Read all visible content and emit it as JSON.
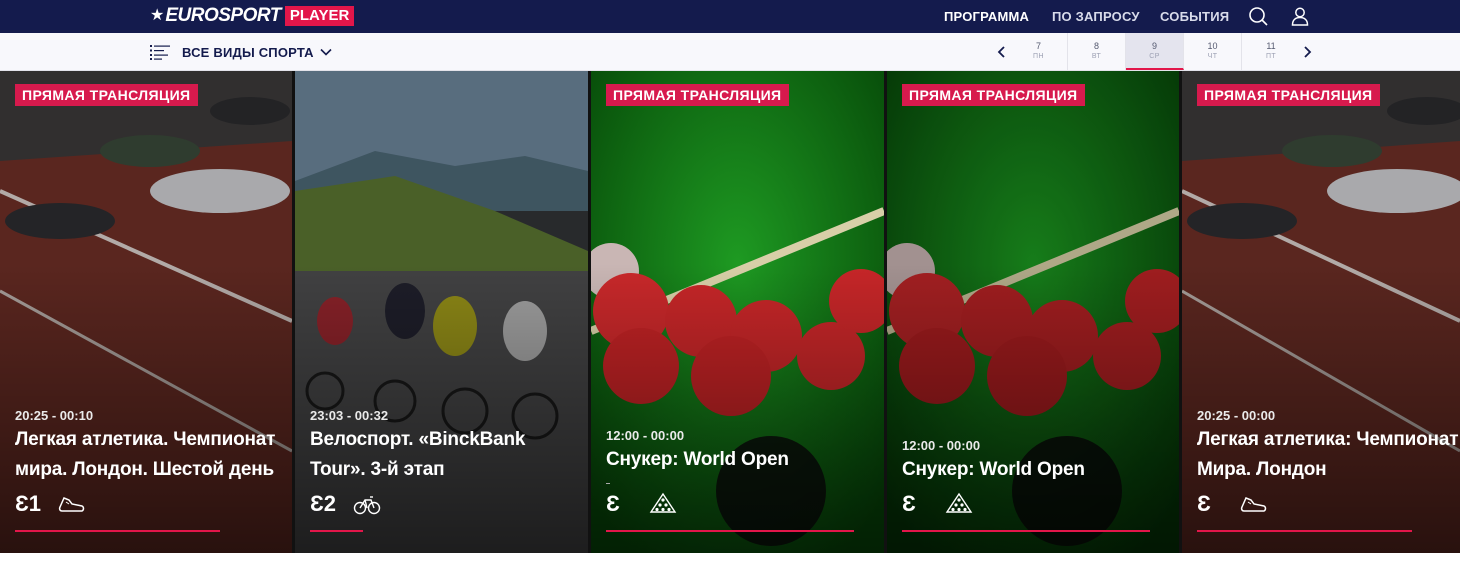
{
  "brand": {
    "name": "EUROSPORT",
    "product": "PLAYER"
  },
  "nav": {
    "links": [
      {
        "label": "ПРОГРАММА",
        "active": true
      },
      {
        "label": "ПО ЗАПРОСУ",
        "active": false
      },
      {
        "label": "СОБЫТИЯ",
        "active": false
      }
    ],
    "icons": [
      "search-icon",
      "user-icon"
    ]
  },
  "filter": {
    "label": "ВСЕ ВИДЫ СПОРТА"
  },
  "dates": [
    {
      "num": "7",
      "dow": "ПН",
      "active": false
    },
    {
      "num": "8",
      "dow": "ВТ",
      "active": false
    },
    {
      "num": "9",
      "dow": "СР",
      "active": true
    },
    {
      "num": "10",
      "dow": "ЧТ",
      "active": false
    },
    {
      "num": "11",
      "dow": "ПТ",
      "active": false
    }
  ],
  "colors": {
    "navy": "#141b4d",
    "accent": "#e2164a",
    "live_badge": "#d71a4d"
  },
  "cards": [
    {
      "live": "ПРЯМАЯ ТРАНСЛЯЦИЯ",
      "time": "20:25 - 00:10",
      "title": "Легкая атлетика. Чемпионат мира. Лондон. Шестой день",
      "channel": "Ɛ1",
      "sport_icon": "running-shoe-icon"
    },
    {
      "live": "",
      "time": "23:03 - 00:32",
      "title": "Велоспорт. «BinckBank Tour». 3-й этап",
      "channel": "Ɛ2",
      "sport_icon": "bicycle-icon"
    },
    {
      "live": "ПРЯМАЯ ТРАНСЛЯЦИЯ",
      "time": "12:00 - 00:00",
      "title": "Снукер: World Open",
      "channel": "Ɛ",
      "sport_icon": "snooker-triangle-icon"
    },
    {
      "live": "ПРЯМАЯ ТРАНСЛЯЦИЯ",
      "time": "12:00 - 00:00",
      "title": "Снукер: World Open",
      "channel": "Ɛ",
      "sport_icon": "snooker-triangle-icon"
    },
    {
      "live": "ПРЯМАЯ ТРАНСЛЯЦИЯ",
      "time": "20:25 - 00:00",
      "title": "Легкая атлетика: Чемпионат Мира. Лондон",
      "channel": "Ɛ",
      "sport_icon": "running-shoe-icon"
    }
  ]
}
